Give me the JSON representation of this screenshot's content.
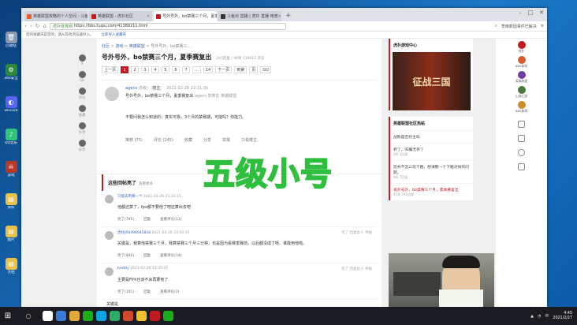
{
  "desktop_icons": [
    {
      "label": "回收站",
      "color": "#8a9bb0",
      "glyph": "🗑"
    },
    {
      "label": "360安全",
      "color": "#2c8a3a",
      "glyph": "⚙"
    },
    {
      "label": "Discord",
      "color": "#5865f2",
      "glyph": "◐"
    },
    {
      "label": "QQ音乐",
      "color": "#31c27c",
      "glyph": "♪"
    },
    {
      "label": "游戏",
      "color": "#b8382a",
      "glyph": "☠"
    },
    {
      "label": "资料",
      "color": "#e8c14a",
      "glyph": "▤"
    },
    {
      "label": "图片",
      "color": "#e8c14a",
      "glyph": "▤"
    },
    {
      "label": "文档",
      "color": "#e8c14a",
      "glyph": "▤"
    }
  ],
  "browser": {
    "tabs": [
      {
        "label": "英雄联盟攻略的个人空间 - 斗鱼",
        "fav": "#e85d2c"
      },
      {
        "label": "英雄联盟 - 虎扑社区",
        "fav": "#c01b22"
      },
      {
        "label": "号外号外，bo禁赛三个月，夏季赛复出",
        "fav": "#c01b22"
      },
      {
        "label": "斗鱼对 直播 | 虎扑 直播 电竞",
        "fav": "#333333"
      }
    ],
    "active_tab": 2,
    "url": "https://bbs.hupu.com/41389211.html",
    "secure_label": "虎扑体育网",
    "addr_right": "李雨菲因事件已解决",
    "bookmarks": [
      "您的收藏夹是空的，请从其他浏览器导入。",
      "立即导入收藏夹"
    ]
  },
  "crumbs": [
    "社区",
    "游戏",
    "英雄联盟",
    "号外号外，bo禁赛三..."
  ],
  "post": {
    "title": "号外号外，bo禁赛三个月，夏季赛复出",
    "meta": "245回复 / 46亮 134615 浏览",
    "pages": [
      "上一页",
      "1",
      "2",
      "3",
      "4",
      "5",
      "6",
      "7",
      "...",
      "14",
      "下一页",
      "到第",
      "页",
      "GO"
    ],
    "author": "agens",
    "author_extra": "(5级)",
    "badge": "楼主",
    "time": "2021-02-26 23:31:35",
    "sub": "号外号外，bo禁赛三个月，夏季赛复出",
    "sub_tag": "agens 发表在 英雄联盟",
    "body": "不要问我怎么知道的，真实可靠，3个月的禁赛期，可能吗？你能力。",
    "actions": [
      "推荐 (75)",
      "评论 (245)",
      "收藏",
      "分享",
      "举报",
      "只看楼主"
    ]
  },
  "replies_section": {
    "title": "这些回帖亮了",
    "more": "查看更多",
    "replies": [
      {
        "user": "只能去用哪一个",
        "time": "2021-02-26 23:32:15",
        "right": "",
        "text": "他都还禁了，fpx都不要他了吧还算出去吧",
        "actions": [
          "亮了(745)",
          "回复",
          "查看评论(11)"
        ]
      },
      {
        "user": "虎扑JR0498645818",
        "time": "2021-02-26 23:34:15",
        "right": "亮了  回复此人  举报",
        "text": "关键是，我算他禁赛三个月，我算禁赛三个月三分钟，也是因为看赛季赛前，以后都没成了呀。谁敢用他啦。",
        "actions": [
          "亮了(492)",
          "回复",
          "查看评论(14)"
        ]
      },
      {
        "user": "brettly",
        "time": "2021-02-26 23:35:45",
        "right": "亮了  回复此人  举报",
        "text": "主要是FPX也该不会再要他了",
        "actions": [
          "亮了(191)",
          "回复",
          "查看评论(2)"
        ]
      }
    ],
    "tail": "关键是"
  },
  "sidebar": {
    "card1_title": "虎扑游戏中心",
    "game_banner": "征战三国",
    "card2_title": "英雄联盟社区热帖",
    "hot": [
      {
        "text": "战败是否好主吗",
        "meta": "",
        "red": false
      },
      {
        "text": "杯了，IG确无存了",
        "meta": "0亮 3回复",
        "red": false
      },
      {
        "text": "玩共不怎么玩下路，想请那一个下路对线的问题。",
        "meta": "0亮 7回复",
        "red": false
      },
      {
        "text": "号外号外，bo禁赛三个月，夏季赛复出",
        "meta": "45亮 245回复",
        "red": true
      }
    ]
  },
  "side_panel": [
    {
      "label": "虎扑",
      "color": "#c01b22"
    },
    {
      "label": "NBA新闻",
      "color": "#d65a2c"
    },
    {
      "label": "英雄联盟",
      "color": "#6a3fa0"
    },
    {
      "label": "山海之道",
      "color": "#4a7a3a"
    },
    {
      "label": "NBA新闻",
      "color": "#d08a2c"
    }
  ],
  "left_rail": [
    "9",
    "56",
    "评论",
    "收藏",
    "分享",
    "分享"
  ],
  "overlay_text": "五级小号",
  "taskbar": {
    "time": "4:45",
    "date": "2021/2/27",
    "lang": "中",
    "apps": [
      "#ffffff",
      "#3a7bd5",
      "#e2a93b",
      "#1aad19",
      "#0ca5e0",
      "#2aae67",
      "#d24a2c",
      "#f2c12e",
      "#c01b22",
      "#1aad19"
    ]
  }
}
